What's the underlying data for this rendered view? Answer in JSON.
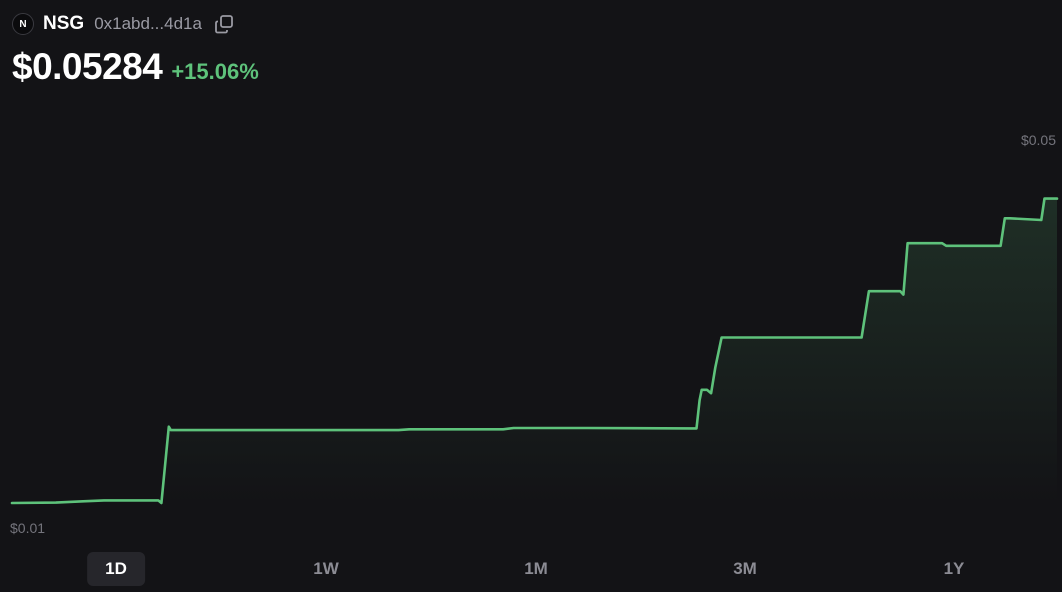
{
  "token": {
    "logo_letter": "N",
    "symbol": "NSG",
    "address": "0x1abd...4d1a",
    "copy_icon": "copy-icon"
  },
  "price": {
    "value": "$0.05284",
    "change": "+15.06%",
    "change_color": "#5ec27b"
  },
  "ranges": {
    "items": [
      "1D",
      "1W",
      "1M",
      "3M",
      "1Y"
    ],
    "active": "1D"
  },
  "chart_data": {
    "type": "area",
    "line_color": "#5ec27b",
    "background": "#131316",
    "grid": false,
    "ymin_label": "$0.01",
    "ymax_label": "$0.05",
    "ylim": [
      0.01,
      0.05
    ],
    "x": [
      0,
      0.042,
      0.068,
      0.088,
      0.14,
      0.143,
      0.15,
      0.152,
      0.2,
      0.37,
      0.38,
      0.47,
      0.48,
      0.55,
      0.65,
      0.655,
      0.658,
      0.66,
      0.665,
      0.669,
      0.673,
      0.679,
      0.68,
      0.74,
      0.8,
      0.813,
      0.82,
      0.85,
      0.853,
      0.857,
      0.862,
      0.89,
      0.894,
      0.946,
      0.95,
      0.955,
      0.985,
      0.988,
      0.994,
      1.0
    ],
    "values": [
      0.01,
      0.01005,
      0.0102,
      0.0103,
      0.0103,
      0.01,
      0.0189,
      0.0185,
      0.0185,
      0.0185,
      0.0186,
      0.0186,
      0.01875,
      0.01875,
      0.0187,
      0.0187,
      0.022,
      0.0232,
      0.0232,
      0.0228,
      0.0258,
      0.0293,
      0.0293,
      0.0293,
      0.0293,
      0.0293,
      0.0347,
      0.0347,
      0.0343,
      0.0403,
      0.0403,
      0.0403,
      0.04,
      0.04,
      0.0432,
      0.0432,
      0.043,
      0.0455,
      0.0455,
      0.0455
    ]
  }
}
